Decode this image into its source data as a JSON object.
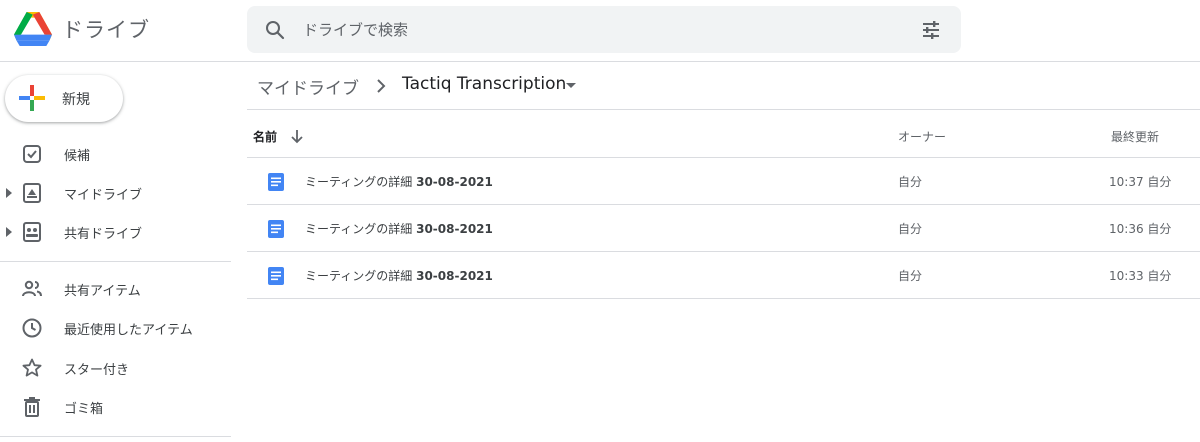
{
  "app": {
    "title": "ドライブ"
  },
  "search": {
    "placeholder": "ドライブで検索"
  },
  "sidebar": {
    "new_label": "新規",
    "items": [
      {
        "label": "候補",
        "icon": "suggested-icon"
      },
      {
        "label": "マイドライブ",
        "icon": "my-drive-icon",
        "expandable": true
      },
      {
        "label": "共有ドライブ",
        "icon": "shared-drives-icon",
        "expandable": true
      },
      {
        "label": "共有アイテム",
        "icon": "people-icon"
      },
      {
        "label": "最近使用したアイテム",
        "icon": "clock-icon"
      },
      {
        "label": "スター付き",
        "icon": "star-icon"
      },
      {
        "label": "ゴミ箱",
        "icon": "trash-icon"
      }
    ]
  },
  "breadcrumb": {
    "root": "マイドライブ",
    "current": "Tactiq Transcription"
  },
  "columns": {
    "name": "名前",
    "owner": "オーナー",
    "modified": "最終更新"
  },
  "files": [
    {
      "name_prefix": "ミーティングの詳細 ",
      "name_date": "30-08-2021",
      "owner": "自分",
      "modified": "10:37 自分"
    },
    {
      "name_prefix": "ミーティングの詳細 ",
      "name_date": "30-08-2021",
      "owner": "自分",
      "modified": "10:36 自分"
    },
    {
      "name_prefix": "ミーティングの詳細 ",
      "name_date": "30-08-2021",
      "owner": "自分",
      "modified": "10:33 自分"
    }
  ],
  "colors": {
    "doc_blue": "#4285f4",
    "google_red": "#ea4335",
    "google_yellow": "#fbbc04",
    "google_green": "#34a853",
    "google_blue": "#4285f4",
    "icon_gray": "#5f6368",
    "divider": "#dadce0"
  }
}
